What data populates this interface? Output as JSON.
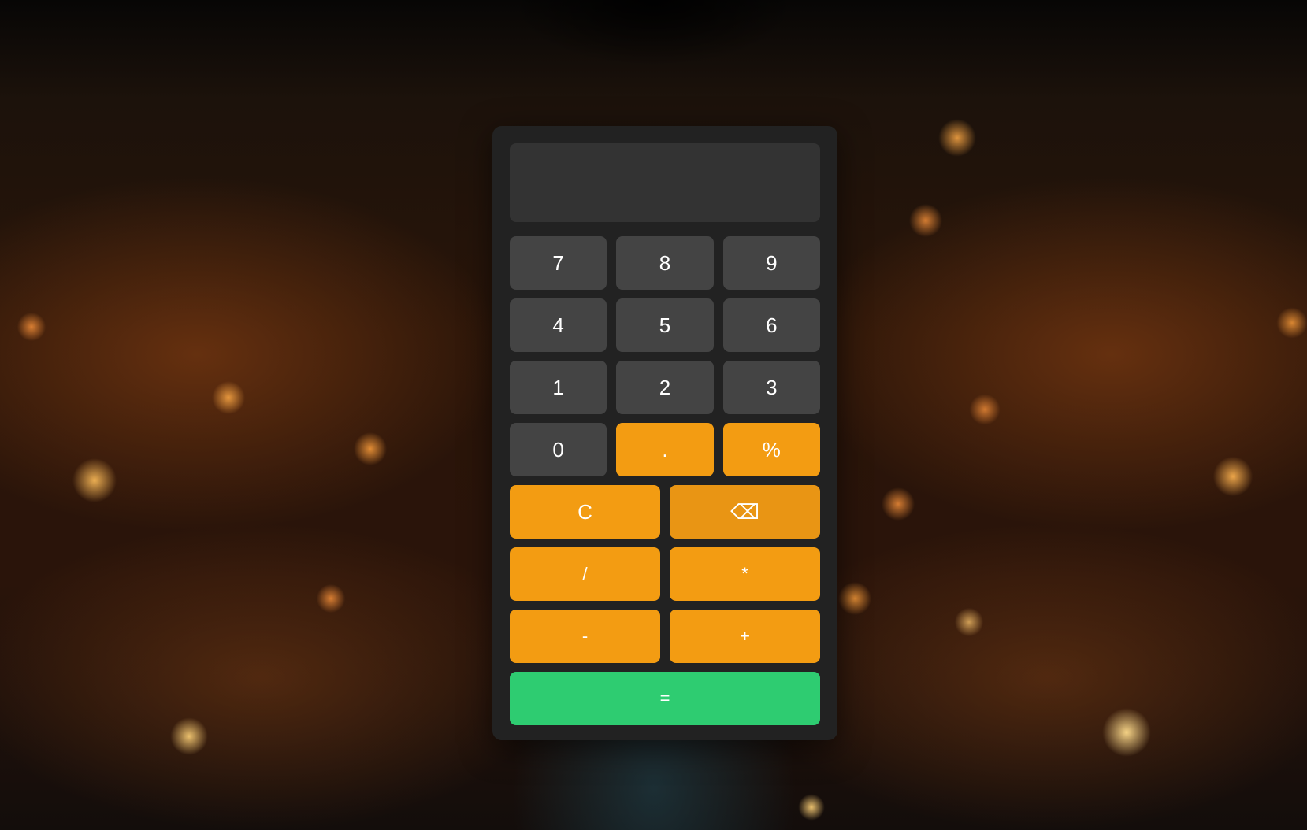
{
  "calculator": {
    "display_value": "",
    "digits": {
      "seven": "7",
      "eight": "8",
      "nine": "9",
      "four": "4",
      "five": "5",
      "six": "6",
      "one": "1",
      "two": "2",
      "three": "3",
      "zero": "0"
    },
    "operators": {
      "decimal": ".",
      "percent": "%",
      "clear": "C",
      "backspace": "⌫",
      "divide": "/",
      "multiply": "*",
      "subtract": "-",
      "add": "+",
      "equals": "="
    },
    "colors": {
      "panel": "#222222",
      "display": "#333333",
      "digit_key": "#444444",
      "operator_key": "#f39c12",
      "equals_key": "#2ecc71",
      "text": "#ffffff"
    }
  }
}
